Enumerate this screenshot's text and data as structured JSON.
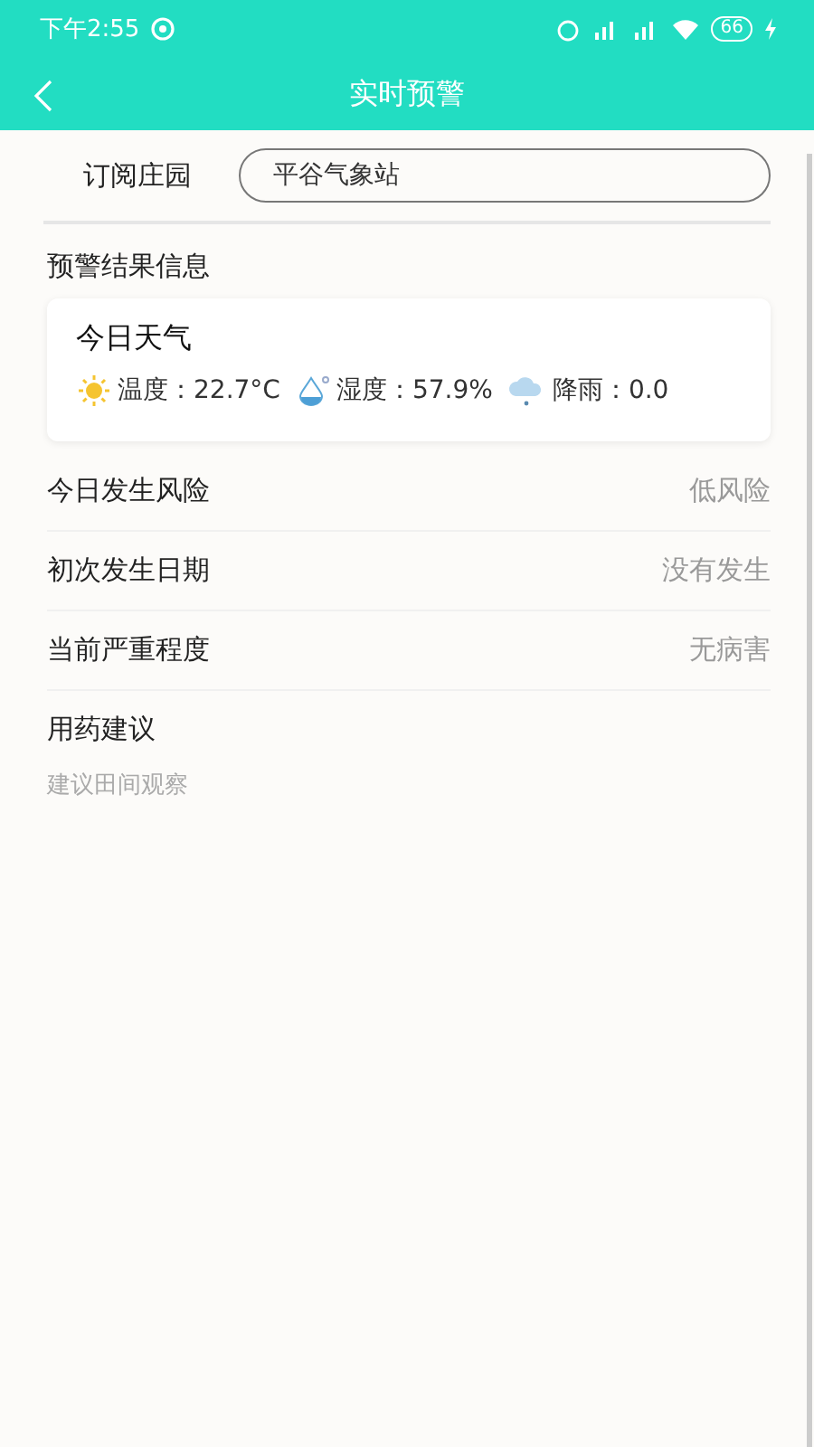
{
  "status_bar": {
    "time": "下午2:55",
    "battery": "66"
  },
  "header": {
    "title": "实时预警"
  },
  "subscription": {
    "label": "订阅庄园",
    "value": "平谷气象站"
  },
  "section_title": "预警结果信息",
  "weather": {
    "title": "今日天气",
    "items": [
      {
        "kind": "sun",
        "text": "温度：22.7°C"
      },
      {
        "kind": "drop",
        "text": "湿度：57.9%"
      },
      {
        "kind": "rain",
        "text": "降雨：0.0"
      }
    ]
  },
  "rows": [
    {
      "label": "今日发生风险",
      "value": "低风险"
    },
    {
      "label": "初次发生日期",
      "value": "没有发生"
    },
    {
      "label": "当前严重程度",
      "value": "无病害"
    }
  ],
  "advice": {
    "title": "用药建议",
    "text": "建议田间观察"
  }
}
